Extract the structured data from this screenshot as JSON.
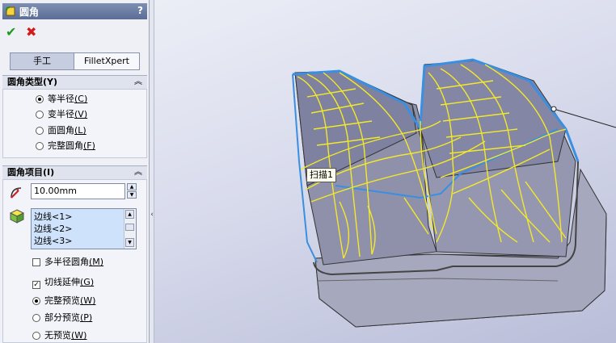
{
  "panel": {
    "title": "圆角",
    "help": "?",
    "ok_symbol": "✔",
    "cancel_symbol": "✖",
    "tabs": [
      "手工",
      "FilletXpert"
    ],
    "fillet_type": {
      "header": "圆角类型(Y)",
      "options": [
        {
          "label": "等半径",
          "key": "(C)",
          "selected": true
        },
        {
          "label": "变半径",
          "key": "(V)",
          "selected": false
        },
        {
          "label": "面圆角",
          "key": "(L)",
          "selected": false
        },
        {
          "label": "完整圆角",
          "key": "(F)",
          "selected": false
        }
      ]
    },
    "fillet_items": {
      "header": "圆角项目(I)",
      "radius_value": "10.00mm",
      "edges": [
        "边线<1>",
        "边线<2>",
        "边线<3>"
      ],
      "multi_radius": {
        "label": "多半径圆角",
        "key": "(M)",
        "checked": false
      },
      "tangent": {
        "label": "切线延伸",
        "key": "(G)",
        "checked": true
      },
      "preview": [
        {
          "label": "完整预览",
          "key": "(W)",
          "selected": true
        },
        {
          "label": "部分预览",
          "key": "(P)",
          "selected": false
        },
        {
          "label": "无预览",
          "key": "(W)",
          "selected": false
        }
      ]
    }
  },
  "viewport": {
    "tooltip": "扫描1"
  }
}
